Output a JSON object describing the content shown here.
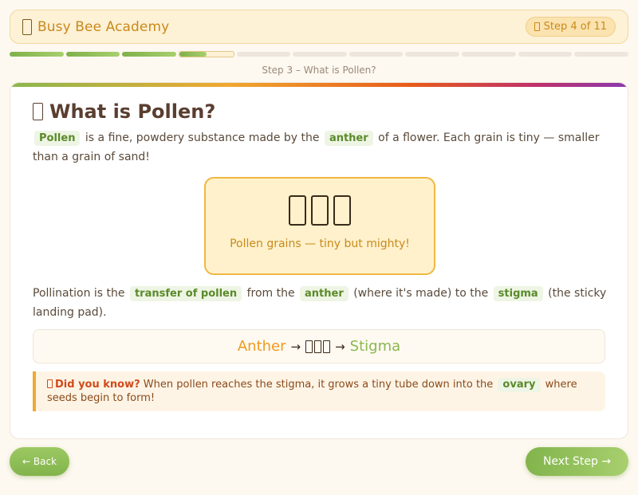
{
  "header": {
    "brand_icon": "bee-icon",
    "brand_title": "Busy Bee Academy",
    "step_icon": "bee-icon",
    "step_label": "Step 4 of 11"
  },
  "progress": {
    "total_steps": 11,
    "completed_steps": 3,
    "current_step_fill_fraction": 0.5
  },
  "step_caption": "Step 3 – What is Pollen?",
  "card": {
    "title_icon": "flower-icon",
    "title": "What is Pollen?",
    "para1": {
      "tag1": "Pollen",
      "text1": "is a fine, powdery substance made by the",
      "tag2": "anther",
      "text2": "of a flower. Each grain is tiny — smaller than a grain of sand!"
    },
    "pollen_box": {
      "grain_icons": [
        "pollen-icon",
        "pollen-icon",
        "pollen-icon"
      ],
      "caption": "Pollen grains — tiny but mighty!"
    },
    "para2": {
      "text1": "Pollination is the",
      "tag1": "transfer of pollen",
      "text2": "from the",
      "tag2": "anther",
      "text3": "(where it's made) to the",
      "tag3": "stigma",
      "text4": "(the sticky landing pad)."
    },
    "flow": {
      "from": "Anther",
      "arrow1": "→",
      "arrow2": "→",
      "to": "Stigma"
    },
    "tip": {
      "icon": "bulb-icon",
      "lead": "Did you know?",
      "text1": "When pollen reaches the stigma, it grows a tiny tube down into the",
      "tag": "ovary",
      "text2": "where seeds begin to form!"
    }
  },
  "nav": {
    "back_label": "← Back",
    "next_label": "Next Step →"
  },
  "colors": {
    "accent_green": "#82b44c",
    "accent_orange": "#f0a830",
    "brand_gold": "#c98a1a"
  }
}
